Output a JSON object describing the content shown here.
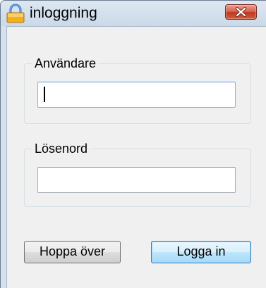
{
  "window": {
    "title": "inloggning",
    "icon": "padlock-icon",
    "close_icon": "close-x-icon"
  },
  "form": {
    "username": {
      "group_label": "Användare",
      "value": "",
      "focused": true
    },
    "password": {
      "group_label": "Lösenord",
      "value": ""
    }
  },
  "buttons": {
    "skip_label": "Hoppa över",
    "login_label": "Logga in"
  },
  "colors": {
    "close_button": "#c8452b",
    "default_button_border": "#3c7fb1",
    "focused_input_border": "#569de5",
    "dialog_background": "#f0f0f0"
  }
}
